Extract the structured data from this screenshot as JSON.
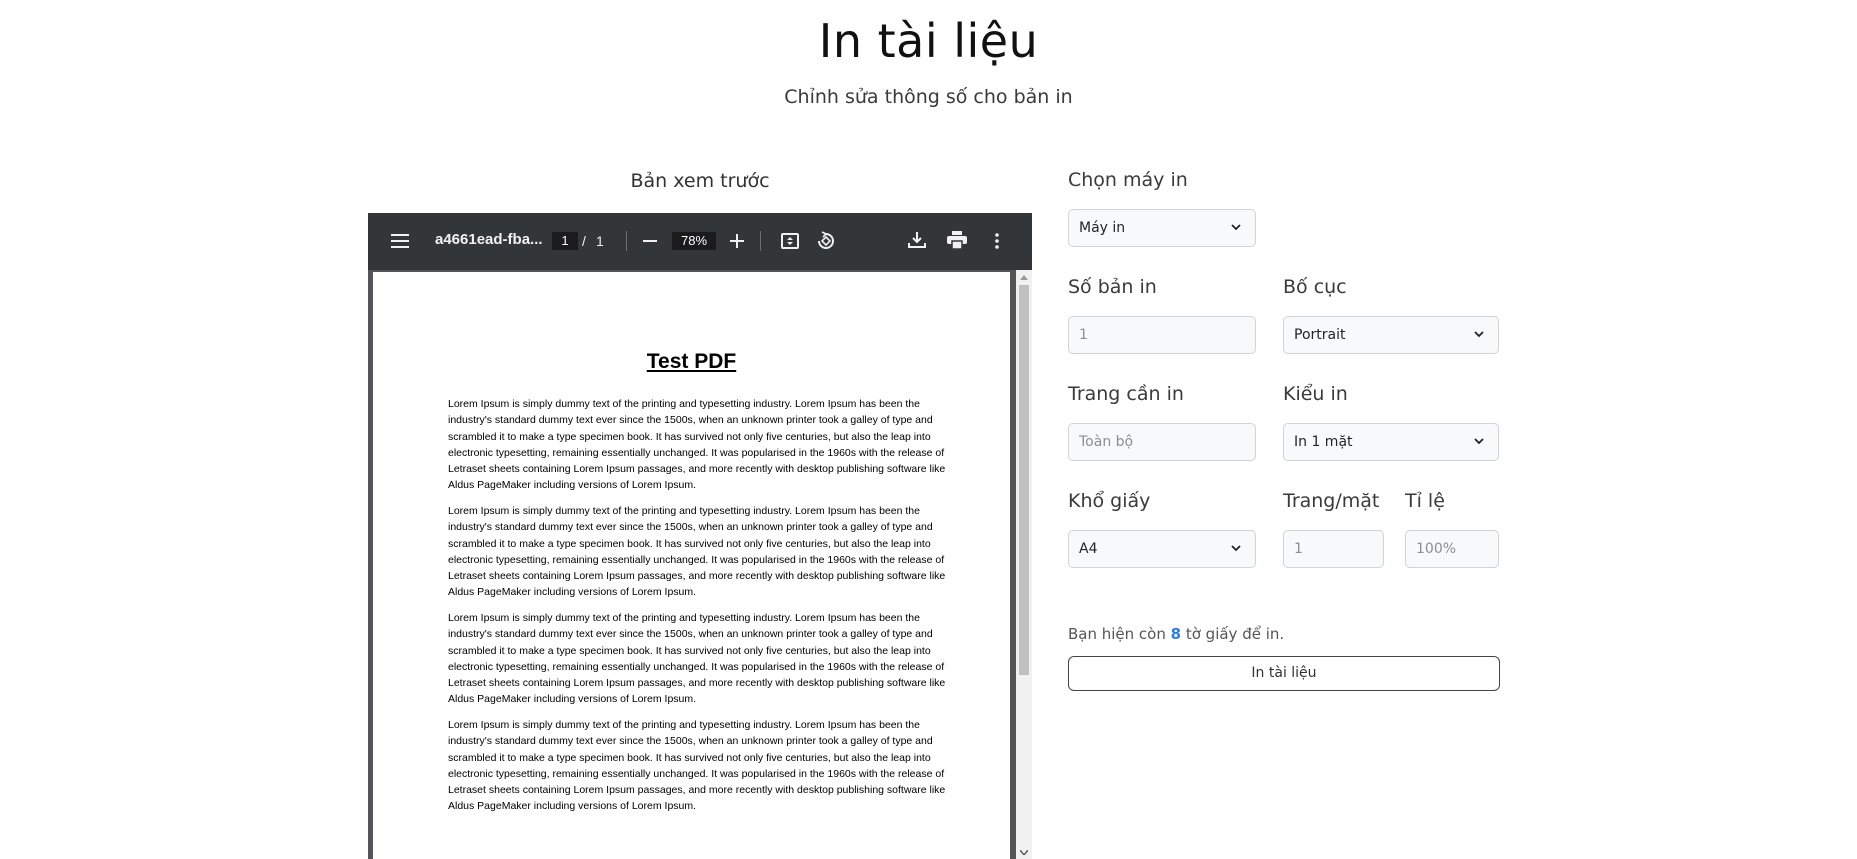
{
  "header": {
    "title": "In tài liệu",
    "subtitle": "Chỉnh sửa thông số cho bản in"
  },
  "preview": {
    "heading": "Bản xem trước",
    "toolbar": {
      "file_name": "a4661ead-fba...",
      "current_page": "1",
      "page_separator": "/",
      "total_pages": "1",
      "zoom": "78%",
      "icons": [
        "menu-icon",
        "zoom-out-icon",
        "zoom-in-icon",
        "fit-page-icon",
        "rotate-icon",
        "download-icon",
        "print-icon",
        "more-icon"
      ]
    },
    "document": {
      "title": "Test PDF",
      "paragraphs": [
        "Lorem Ipsum is simply dummy text of the printing and typesetting industry. Lorem Ipsum has been the industry's standard dummy text ever since the 1500s, when an unknown printer took a galley of type and scrambled it to make a type specimen book. It has survived not only five centuries, but also the leap into electronic typesetting, remaining essentially unchanged. It was popularised in the 1960s with the release of Letraset sheets containing Lorem Ipsum passages, and more recently with desktop publishing software like Aldus PageMaker including versions of Lorem Ipsum.",
        "Lorem Ipsum is simply dummy text of the printing and typesetting industry. Lorem Ipsum has been the industry's standard dummy text ever since the 1500s, when an unknown printer took a galley of type and scrambled it to make a type specimen book. It has survived not only five centuries, but also the leap into electronic typesetting, remaining essentially unchanged. It was popularised in the 1960s with the release of Letraset sheets containing Lorem Ipsum passages, and more recently with desktop publishing software like Aldus PageMaker including versions of Lorem Ipsum.",
        "Lorem Ipsum is simply dummy text of the printing and typesetting industry. Lorem Ipsum has been the industry's standard dummy text ever since the 1500s, when an unknown printer took a galley of type and scrambled it to make a type specimen book. It has survived not only five centuries, but also the leap into electronic typesetting, remaining essentially unchanged. It was popularised in the 1960s with the release of Letraset sheets containing Lorem Ipsum passages, and more recently with desktop publishing software like Aldus PageMaker including versions of Lorem Ipsum.",
        "Lorem Ipsum is simply dummy text of the printing and typesetting industry. Lorem Ipsum has been the industry's standard dummy text ever since the 1500s, when an unknown printer took a galley of type and scrambled it to make a type specimen book. It has survived not only five centuries, but also the leap into electronic typesetting, remaining essentially unchanged. It was popularised in the 1960s with the release of Letraset sheets containing Lorem Ipsum passages, and more recently with desktop publishing software like Aldus PageMaker including versions of Lorem Ipsum."
      ]
    }
  },
  "settings": {
    "printer": {
      "label": "Chọn máy in",
      "value": "Máy in"
    },
    "copies": {
      "label": "Số bản in",
      "value": "1"
    },
    "layout": {
      "label": "Bố cục",
      "value": "Portrait"
    },
    "pages": {
      "label": "Trang cần in",
      "placeholder": "Toàn bộ"
    },
    "sides": {
      "label": "Kiểu in",
      "value": "In 1 mặt"
    },
    "paper_size": {
      "label": "Khổ giấy",
      "value": "A4"
    },
    "pages_per_sheet": {
      "label": "Trang/mặt",
      "value": "1"
    },
    "scale": {
      "label": "Tỉ lệ",
      "value": "100%"
    }
  },
  "footer": {
    "remaining_prefix": "Bạn hiện còn ",
    "remaining_count": "8",
    "remaining_suffix": " tờ giấy để in.",
    "print_button": "In tài liệu"
  },
  "colors": {
    "toolbar_bg": "#323639",
    "viewer_bg": "#525659",
    "field_bg": "#f8f9fa",
    "accent": "#2b7de9"
  }
}
